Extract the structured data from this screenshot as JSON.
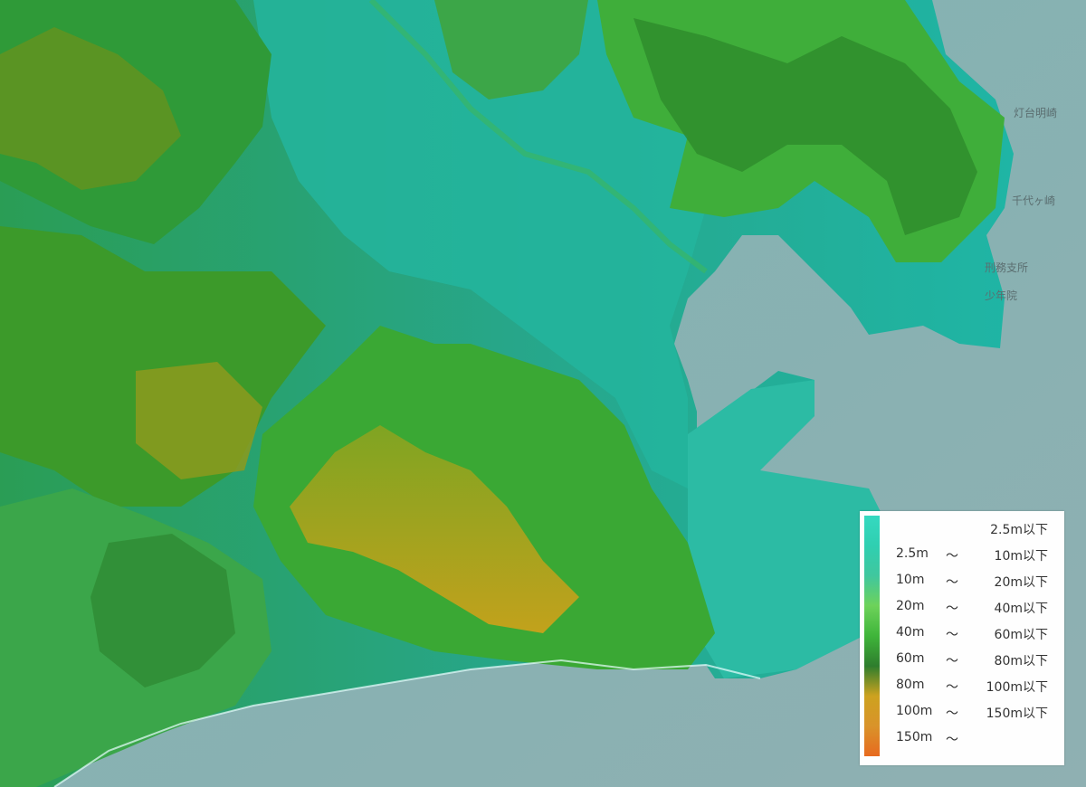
{
  "place_labels": [
    "灯台明崎",
    "千代ヶ崎",
    "刑務支所",
    "少年院"
  ],
  "legend": {
    "rows": [
      {
        "lo": "",
        "tilde": "",
        "hi": "2.5m以下"
      },
      {
        "lo": "2.5m",
        "tilde": "〜",
        "hi": "10m以下"
      },
      {
        "lo": "10m",
        "tilde": "〜",
        "hi": "20m以下"
      },
      {
        "lo": "20m",
        "tilde": "〜",
        "hi": "40m以下"
      },
      {
        "lo": "40m",
        "tilde": "〜",
        "hi": "60m以下"
      },
      {
        "lo": "60m",
        "tilde": "〜",
        "hi": "80m以下"
      },
      {
        "lo": "80m",
        "tilde": "〜",
        "hi": "100m以下"
      },
      {
        "lo": "100m",
        "tilde": "〜",
        "hi": "150m以下"
      },
      {
        "lo": "150m",
        "tilde": "〜",
        "hi": ""
      }
    ],
    "colors": [
      "#35d9c0",
      "#2fcfb1",
      "#40c79e",
      "#6dd25a",
      "#3fb53a",
      "#2e7d2d",
      "#cda21f",
      "#d9932a",
      "#e76a1f"
    ]
  }
}
